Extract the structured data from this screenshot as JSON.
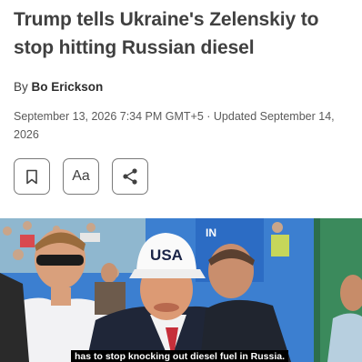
{
  "article": {
    "headline": "Trump tells Ukraine's Zelenskiy to stop hitting Russian diesel",
    "byline_prefix": "By",
    "author": "Bo Erickson",
    "dateline": "September 13, 2026 7:34 PM GMT+5 · Updated September 14, 2026"
  },
  "toolbar": {
    "bookmark_icon": "bookmark-icon",
    "text_size_label": "Aa",
    "share_icon": "share-icon"
  },
  "hero": {
    "cap_text": "USA",
    "caption": "has to stop knocking out diesel fuel in Russia.",
    "backdrop_text": "IN"
  },
  "colors": {
    "headline": "#404040",
    "stadium_blue": "#2f7ed8",
    "caption_bg": "#000000"
  }
}
